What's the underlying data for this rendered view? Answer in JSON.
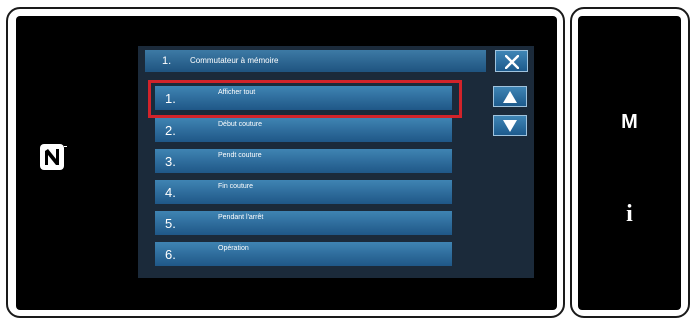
{
  "dialog": {
    "title_number": "1.",
    "title": "Commutateur à mémoire",
    "close_icon": "close-icon"
  },
  "scroll": {
    "up_icon": "arrow-up-icon",
    "down_icon": "arrow-down-icon"
  },
  "items": [
    {
      "number": "1.",
      "label": "Afficher tout",
      "selected": true
    },
    {
      "number": "2.",
      "label": "Début couture"
    },
    {
      "number": "3.",
      "label": "Pendt couture"
    },
    {
      "number": "4.",
      "label": "Fin couture"
    },
    {
      "number": "5.",
      "label": "Pendant l'arrêt"
    },
    {
      "number": "6.",
      "label": "Opération"
    }
  ],
  "side": {
    "mode_label": "M",
    "info_label": "i"
  },
  "nfc_icon": "nfc-icon",
  "colors": {
    "button_blue": "#2f6fa0",
    "highlight_red": "#d2232a",
    "screen_black": "#000000"
  }
}
